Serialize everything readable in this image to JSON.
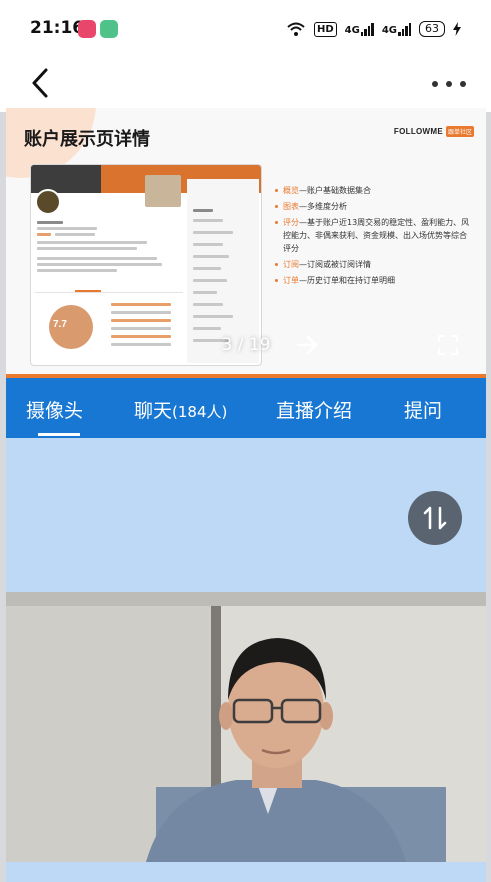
{
  "status_bar": {
    "time": "21:16",
    "hd": "HD",
    "net1": "4G",
    "net2": "4G",
    "battery": "63",
    "app_icons": [
      "app-icon-red",
      "app-icon-green"
    ]
  },
  "nav": {
    "back_icon": "chevron-left-icon",
    "more_icon": "more-dots-icon"
  },
  "slide": {
    "title": "账户展示页详情",
    "brand": "FOLLOWME",
    "brand_badge": "跟单社区",
    "bullets": [
      {
        "keyword": "概览",
        "text": "—账户基础数据集合"
      },
      {
        "keyword": "图表",
        "text": "—多维度分析"
      },
      {
        "keyword": "评分",
        "text": "—基于账户近13周交易的稳定性、盈利能力、风控能力、非偶来获利、资金规模、出入场优势等综合评分"
      },
      {
        "keyword": "订阅",
        "text": "—订阅或被订阅详情"
      },
      {
        "keyword": "订单",
        "text": "—历史订单和在持订单明细"
      }
    ],
    "score": "7.7",
    "page_current": "3",
    "page_total": "19",
    "page_label": "3 / 19"
  },
  "tabs": [
    {
      "label": "摄像头",
      "count": ""
    },
    {
      "label": "聊天",
      "count": "(184人)"
    },
    {
      "label": "直播介绍",
      "count": ""
    },
    {
      "label": "提问",
      "count": ""
    }
  ],
  "active_tab": 0,
  "colors": {
    "tab_bar": "#1877d2",
    "content_bg": "#bdd9f6",
    "accent": "#e8792e"
  }
}
